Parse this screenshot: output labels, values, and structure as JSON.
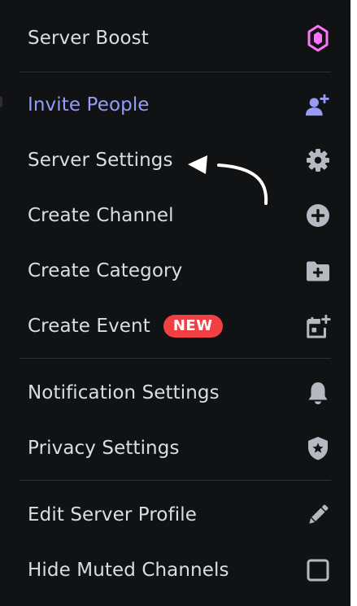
{
  "menu": {
    "items": [
      {
        "label": "Server Boost",
        "icon": "boost-gem-icon"
      },
      {
        "label": "Invite People",
        "icon": "add-person-icon",
        "accent": "#949cf7"
      },
      {
        "label": "Server Settings",
        "icon": "gear-icon"
      },
      {
        "label": "Create Channel",
        "icon": "plus-circle-icon"
      },
      {
        "label": "Create Category",
        "icon": "folder-plus-icon"
      },
      {
        "label": "Create Event",
        "icon": "calendar-plus-icon",
        "badge": "NEW"
      },
      {
        "label": "Notification Settings",
        "icon": "bell-icon"
      },
      {
        "label": "Privacy Settings",
        "icon": "shield-star-icon"
      },
      {
        "label": "Edit Server Profile",
        "icon": "pencil-icon"
      },
      {
        "label": "Hide Muted Channels",
        "icon": "checkbox-icon"
      }
    ]
  },
  "colors": {
    "background": "#111214",
    "text": "#dbdee1",
    "accent": "#949cf7",
    "badge": "#f23f43",
    "boost": "#ff73fa"
  }
}
